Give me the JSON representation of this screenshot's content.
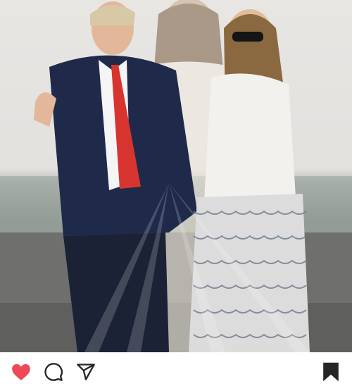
{
  "post": {
    "photo_alt": "",
    "actions": {
      "like_icon": "heart-filled",
      "like_color": "#ed4956",
      "comment_icon": "speech-bubble",
      "share_icon": "paper-plane",
      "save_icon": "bookmark-filled"
    },
    "colors": {
      "icon": "#262626",
      "background": "#ffffff"
    }
  }
}
